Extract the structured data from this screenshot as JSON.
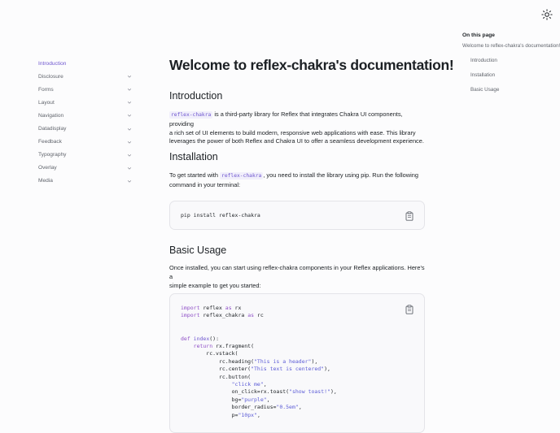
{
  "sidebar": {
    "items": [
      {
        "label": "Introduction",
        "active": true,
        "expandable": false
      },
      {
        "label": "Disclosure",
        "expandable": true
      },
      {
        "label": "Forms",
        "expandable": true
      },
      {
        "label": "Layout",
        "expandable": true
      },
      {
        "label": "Navigation",
        "expandable": true
      },
      {
        "label": "Datadisplay",
        "expandable": true
      },
      {
        "label": "Feedback",
        "expandable": true
      },
      {
        "label": "Typography",
        "expandable": true
      },
      {
        "label": "Overlay",
        "expandable": true
      },
      {
        "label": "Media",
        "expandable": true
      }
    ]
  },
  "toc": {
    "title": "On this page",
    "items": [
      {
        "label": "Welcome to reflex-chakra's documentation!"
      },
      {
        "label": "Introduction"
      },
      {
        "label": "Installation"
      },
      {
        "label": "Basic Usage"
      }
    ]
  },
  "main": {
    "title": "Welcome to reflex-chakra's documentation!",
    "intro_heading": "Introduction",
    "intro_code": "reflex-chakra",
    "intro_text_line1": " is a third-party library for Reflex that integrates Chakra UI components, providing",
    "intro_text_line2": "a rich set of UI elements to build modern, responsive web applications with ease. This library",
    "intro_text_line3": "leverages the power of both Reflex and Chakra UI to offer a seamless development experience.",
    "install_heading": "Installation",
    "install_text_a": "To get started with ",
    "install_code": "reflex-chakra",
    "install_text_b": ", you need to install the library using pip. Run the following",
    "install_text_line2": "command in your terminal:",
    "install_command": "pip install reflex-chakra",
    "usage_heading": "Basic Usage",
    "usage_text_line1": "Once installed, you can start using reflex-chakra components in your Reflex applications. Here's a",
    "usage_text_line2": "simple example to get you started:"
  },
  "colors": {
    "accent": "#6e56cf",
    "text": "#1c2024",
    "muted": "#60646c",
    "code_bg": "#f9f9fb"
  },
  "icons": {
    "theme_toggle": "sun-icon",
    "copy": "clipboard-icon",
    "expand": "chevron-down-icon"
  }
}
